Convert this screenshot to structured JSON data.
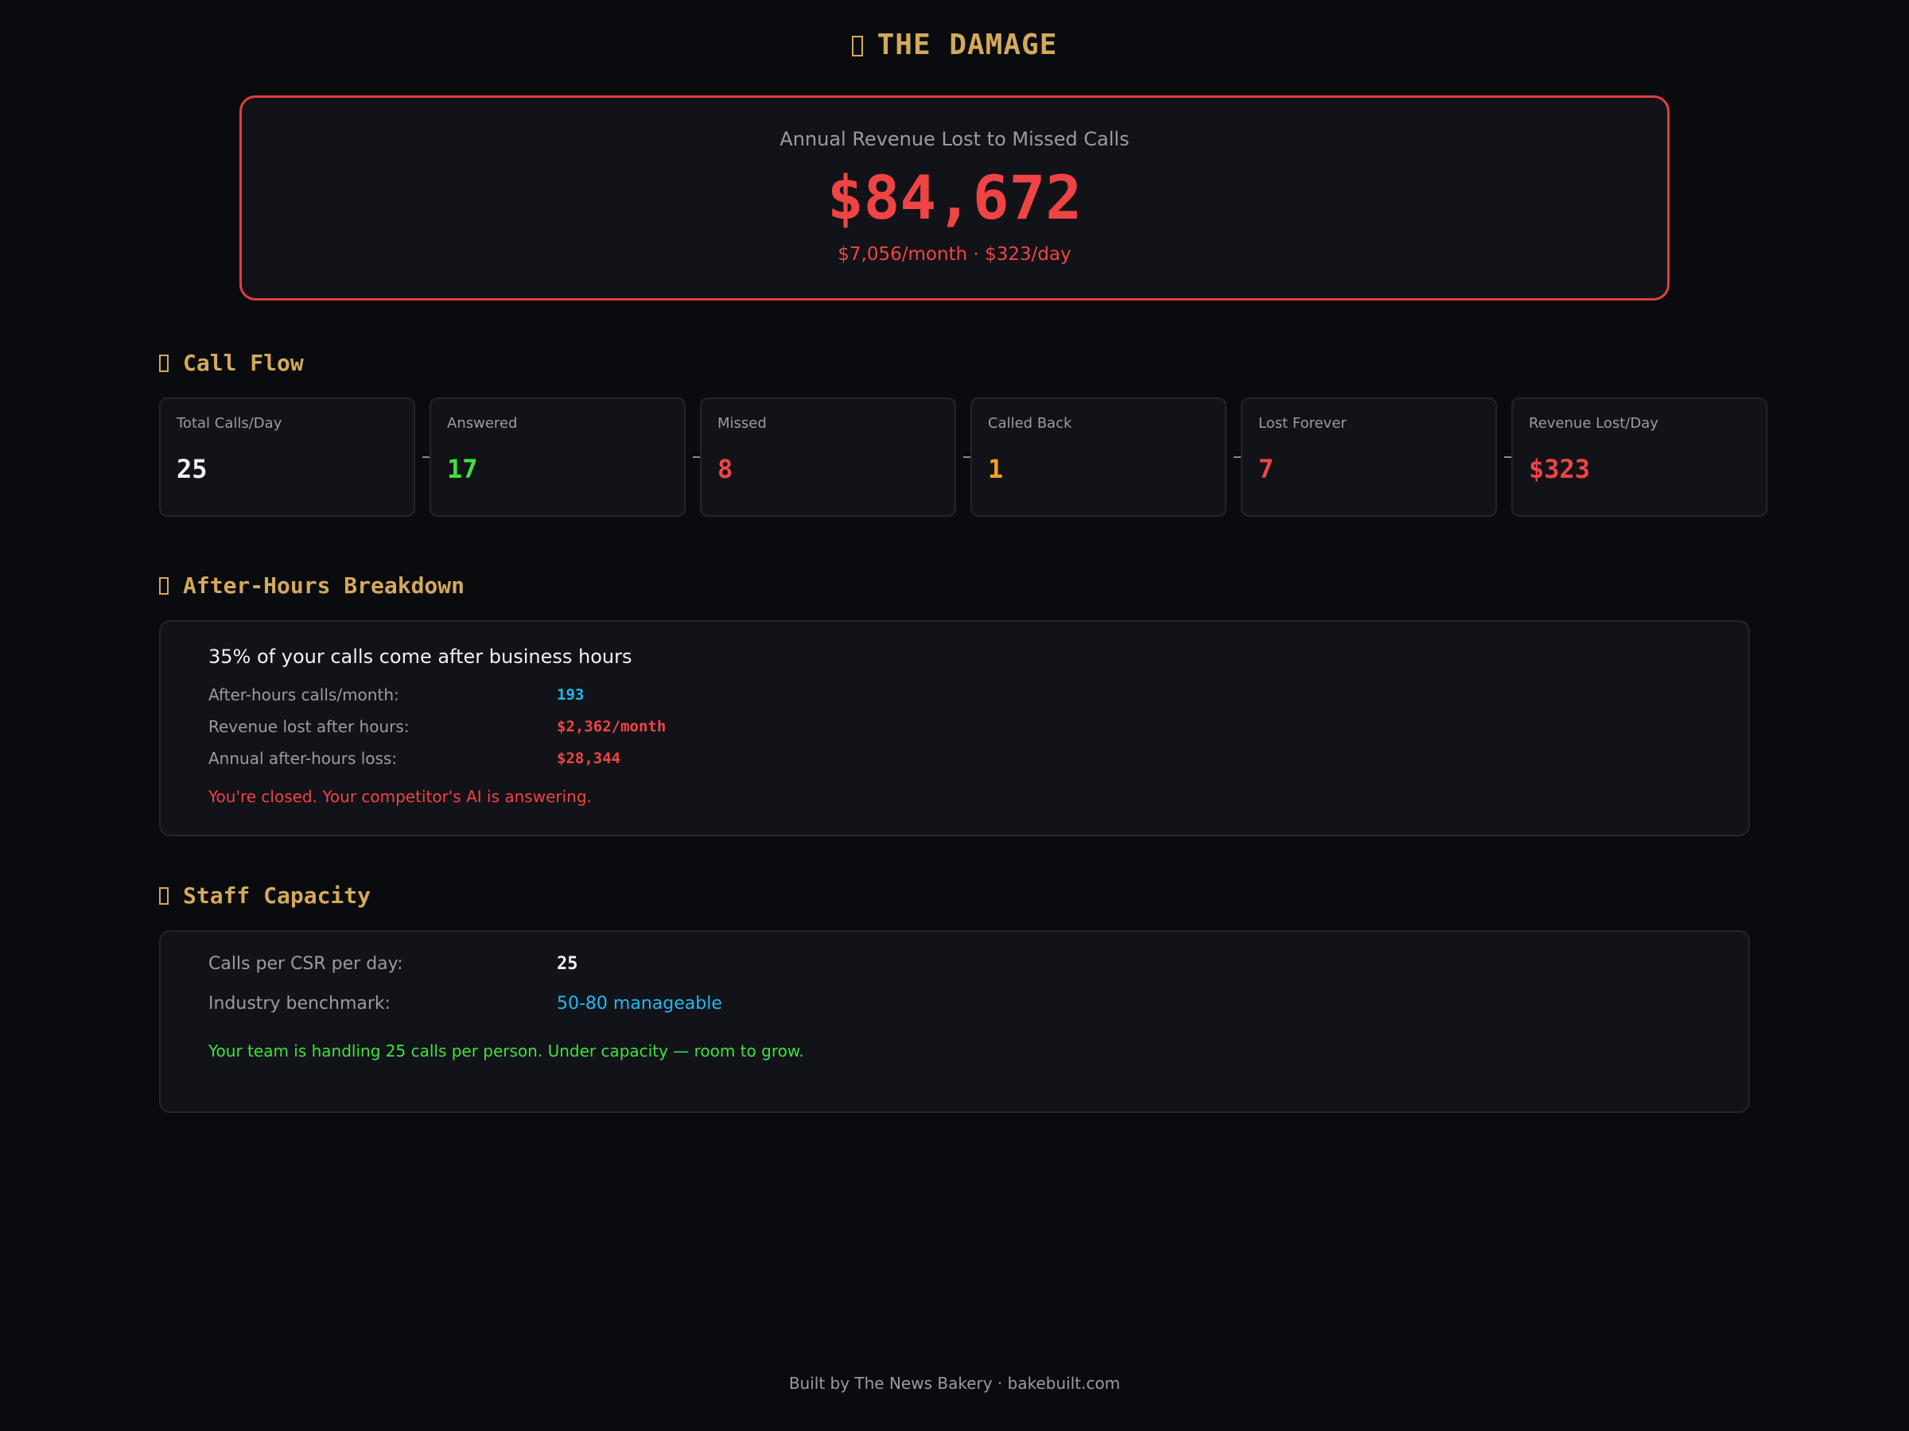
{
  "header": {
    "title": "THE DAMAGE",
    "icon": "glyph-box-icon"
  },
  "damage": {
    "label": "Annual Revenue Lost to Missed Calls",
    "amount": "$84,672",
    "sub": "$7,056/month · $323/day",
    "color": "#f04444"
  },
  "call_flow": {
    "heading": "Call Flow",
    "cards": [
      {
        "label": "Total Calls/Day",
        "value": "25",
        "color": "#f2f2f4"
      },
      {
        "label": "Answered",
        "value": "17",
        "color": "#3ee23e"
      },
      {
        "label": "Missed",
        "value": "8",
        "color": "#f04444"
      },
      {
        "label": "Called Back",
        "value": "1",
        "color": "#f0a020"
      },
      {
        "label": "Lost Forever",
        "value": "7",
        "color": "#f04444"
      },
      {
        "label": "Revenue Lost/Day",
        "value": "$323",
        "color": "#f04444"
      }
    ]
  },
  "after_hours": {
    "heading": "After-Hours Breakdown",
    "headline": "35% of your calls come after business hours",
    "rows": [
      {
        "label": "After-hours calls/month:",
        "value": "193",
        "color": "#22b8f0"
      },
      {
        "label": "Revenue lost after hours:",
        "value": "$2,362/month",
        "color": "#f04444"
      },
      {
        "label": "Annual after-hours loss:",
        "value": "$28,344",
        "color": "#f04444"
      }
    ],
    "warning": "You're closed. Your competitor's AI is answering."
  },
  "staff": {
    "heading": "Staff Capacity",
    "rows": [
      {
        "label": "Calls per CSR per day:",
        "value": "25",
        "color": "#f2f2f4"
      },
      {
        "label": "Industry benchmark:",
        "value": "50-80 manageable",
        "color": "#22b8f0"
      }
    ],
    "note": "Your team is handling 25 calls per person. Under capacity — room to grow."
  },
  "footer": {
    "text": "Built by The News Bakery · bakebuilt.com"
  }
}
